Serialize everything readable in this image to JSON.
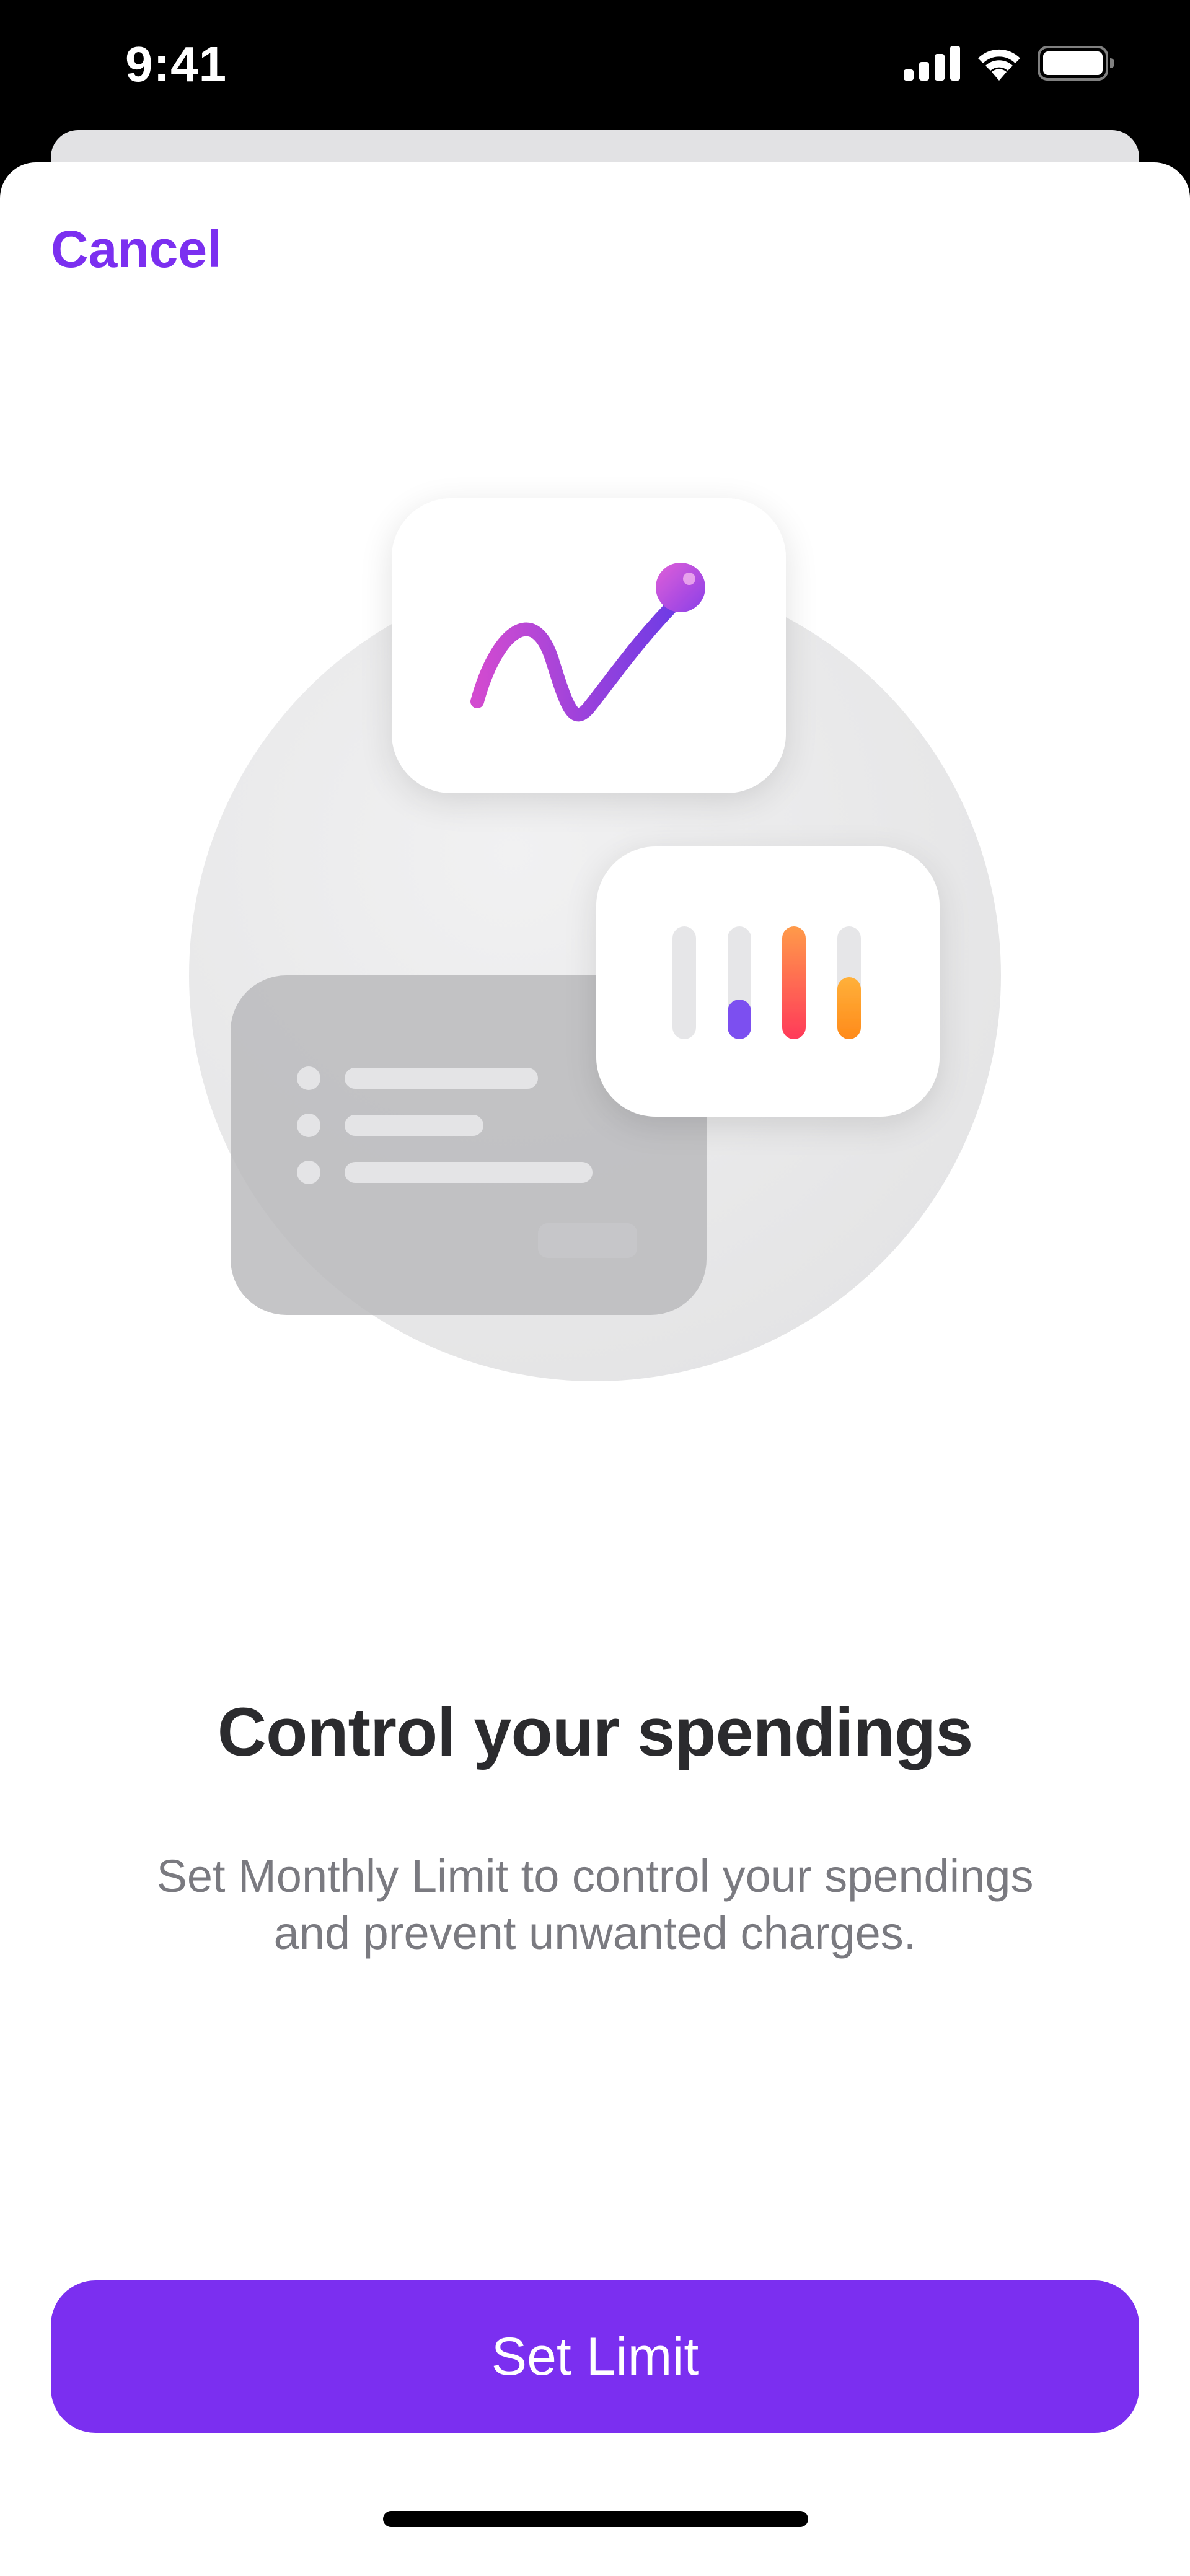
{
  "status_bar": {
    "time": "9:41",
    "icons": [
      "cellular-signal-icon",
      "wifi-icon",
      "battery-icon"
    ]
  },
  "sheet": {
    "cancel_label": "Cancel",
    "illustration_icons": [
      "line-graph-icon",
      "bar-levels-icon",
      "list-card-icon"
    ],
    "title": "Control your spendings",
    "subtitle_line1": "Set Monthly Limit to control your spendings",
    "subtitle_line2": "and prevent unwanted charges.",
    "primary_button_label": "Set Limit"
  },
  "colors": {
    "accent": "#7b2ff0",
    "title_text": "#2b2b2e",
    "subtitle_text": "#7a7a80",
    "background": "#ffffff"
  }
}
